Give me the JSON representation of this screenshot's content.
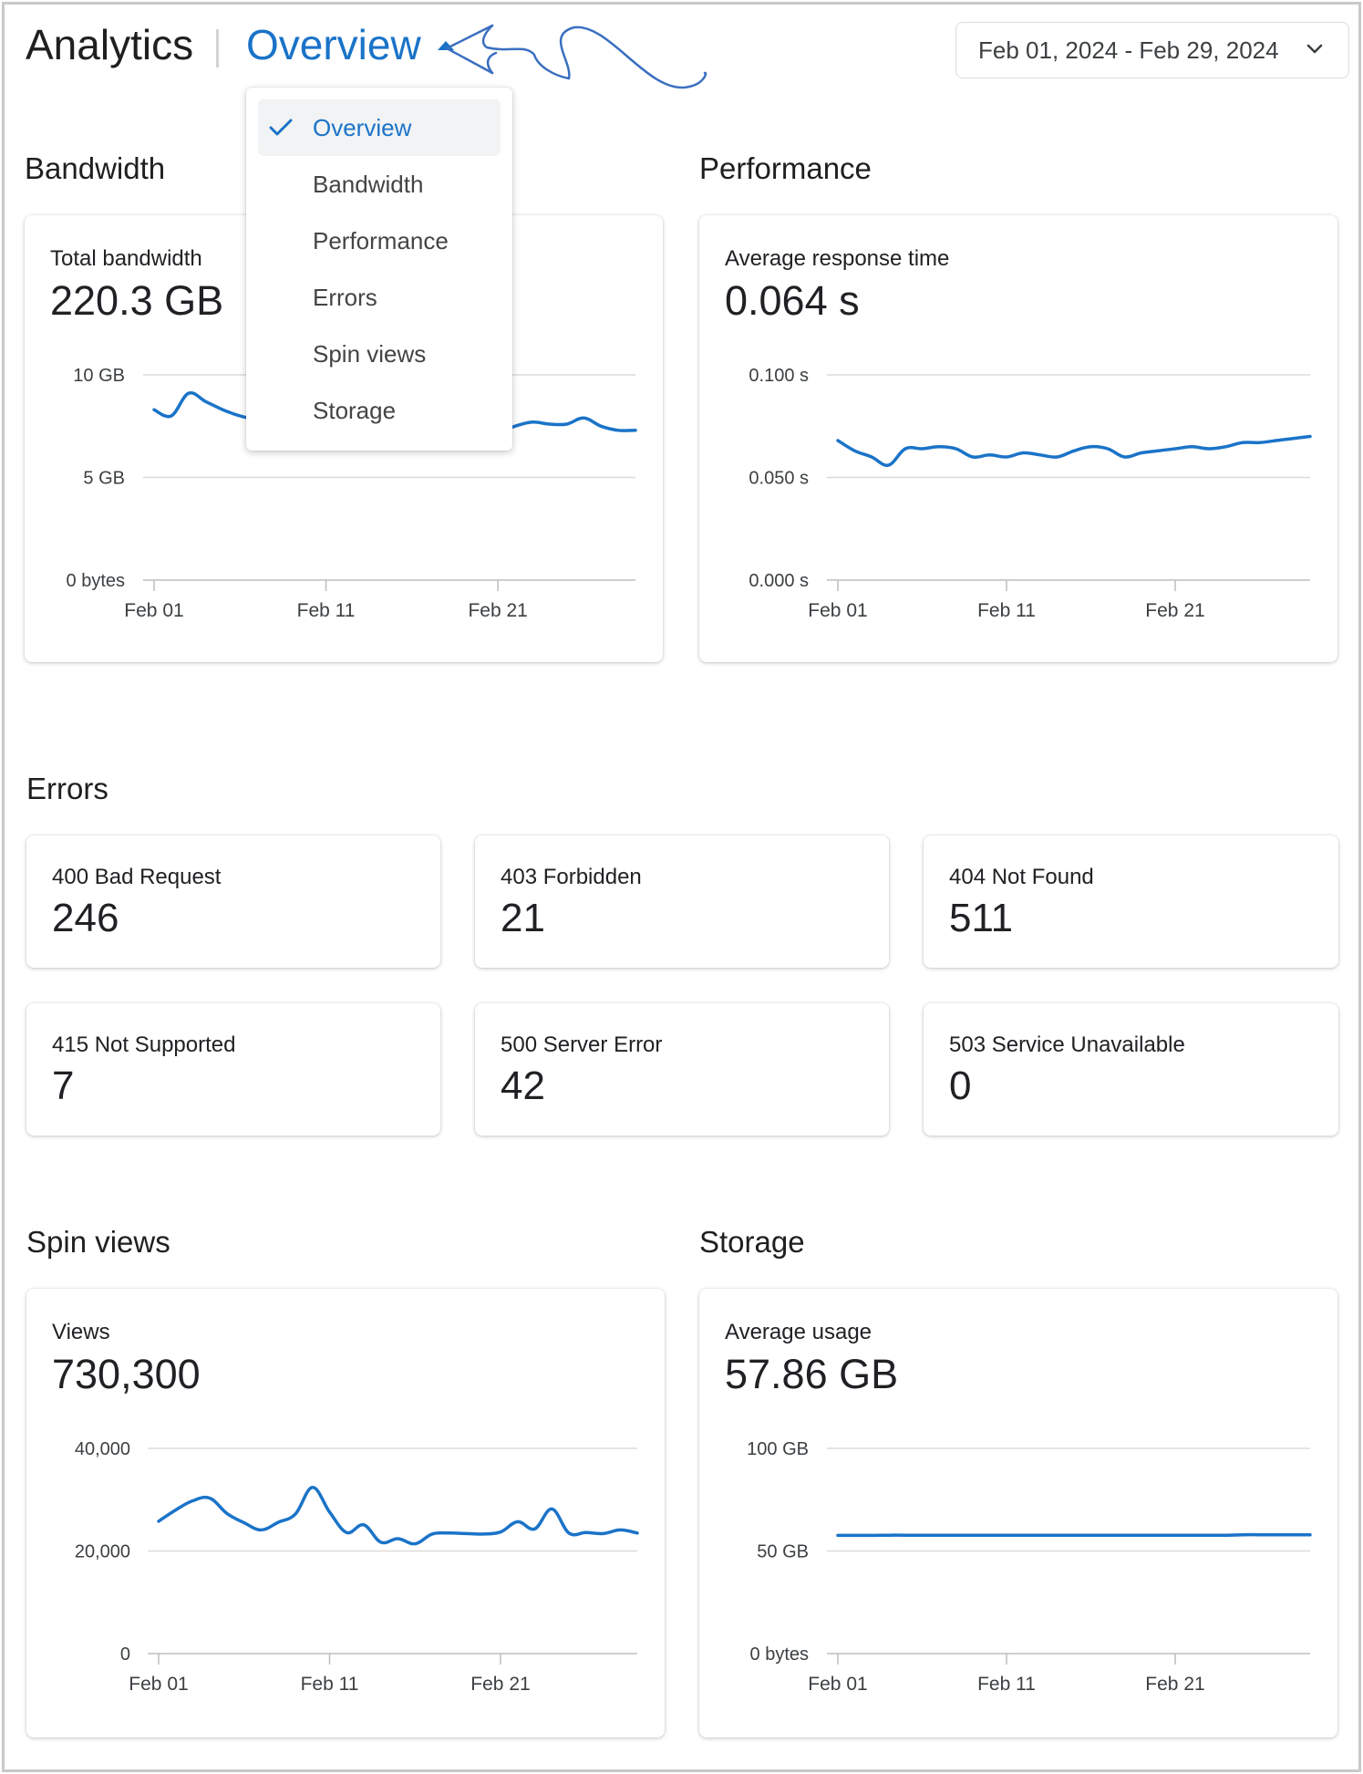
{
  "header": {
    "app_title": "Analytics",
    "section_selected": "Overview",
    "date_range": "Feb 01, 2024 - Feb 29, 2024"
  },
  "dropdown": {
    "items": [
      "Overview",
      "Bandwidth",
      "Performance",
      "Errors",
      "Spin views",
      "Storage"
    ],
    "selected": "Overview"
  },
  "colors": {
    "accent": "#1a73c8",
    "line": "#1a73c8"
  },
  "sections": {
    "bandwidth": "Bandwidth",
    "performance": "Performance",
    "errors": "Errors",
    "spin_views": "Spin views",
    "storage": "Storage"
  },
  "bandwidth": {
    "label": "Total bandwidth",
    "value": "220.3 GB"
  },
  "performance": {
    "label": "Average response time",
    "value": "0.064 s"
  },
  "spin_views": {
    "label": "Views",
    "value": "730,300"
  },
  "storage": {
    "label": "Average usage",
    "value": "57.86 GB"
  },
  "errors": [
    {
      "label": "400 Bad Request",
      "value": "246"
    },
    {
      "label": "403 Forbidden",
      "value": "21"
    },
    {
      "label": "404 Not Found",
      "value": "511"
    },
    {
      "label": "415 Not Supported",
      "value": "7"
    },
    {
      "label": "500 Server Error",
      "value": "42"
    },
    {
      "label": "503 Service Unavailable",
      "value": "0"
    }
  ],
  "chart_data": [
    {
      "type": "line",
      "title": "Total bandwidth",
      "x_ticks": [
        "Feb 01",
        "Feb 11",
        "Feb 21"
      ],
      "y_ticks": [
        "0 bytes",
        "5 GB",
        "10 GB"
      ],
      "ylim": [
        0,
        10
      ],
      "x": [
        1,
        2,
        3,
        4,
        5,
        6,
        7,
        8,
        9,
        10,
        11,
        12,
        13,
        14,
        15,
        16,
        17,
        18,
        19,
        20,
        21,
        22,
        23,
        24,
        25,
        26,
        27,
        28,
        29
      ],
      "series": [
        {
          "values": [
            8.3,
            8.0,
            9.1,
            8.7,
            8.3,
            8.0,
            7.8,
            7.6,
            7.3,
            7.0,
            6.8,
            6.6,
            6.5,
            6.4,
            6.6,
            6.9,
            7.2,
            7.3,
            7.3,
            7.2,
            7.2,
            7.5,
            7.7,
            7.6,
            7.6,
            7.9,
            7.5,
            7.3,
            7.3
          ]
        }
      ]
    },
    {
      "type": "line",
      "title": "Average response time",
      "x_ticks": [
        "Feb 01",
        "Feb 11",
        "Feb 21"
      ],
      "y_ticks": [
        "0.000 s",
        "0.050 s",
        "0.100 s"
      ],
      "ylim": [
        0,
        0.1
      ],
      "x": [
        1,
        2,
        3,
        4,
        5,
        6,
        7,
        8,
        9,
        10,
        11,
        12,
        13,
        14,
        15,
        16,
        17,
        18,
        19,
        20,
        21,
        22,
        23,
        24,
        25,
        26,
        27,
        28,
        29
      ],
      "series": [
        {
          "values": [
            0.068,
            0.063,
            0.06,
            0.056,
            0.064,
            0.064,
            0.065,
            0.064,
            0.06,
            0.061,
            0.06,
            0.062,
            0.061,
            0.06,
            0.063,
            0.065,
            0.064,
            0.06,
            0.062,
            0.063,
            0.064,
            0.065,
            0.064,
            0.065,
            0.067,
            0.067,
            0.068,
            0.069,
            0.07
          ]
        }
      ]
    },
    {
      "type": "line",
      "title": "Views",
      "x_ticks": [
        "Feb 01",
        "Feb 11",
        "Feb 21"
      ],
      "y_ticks": [
        "0",
        "20,000",
        "40,000"
      ],
      "ylim": [
        0,
        40000
      ],
      "x": [
        1,
        2,
        3,
        4,
        5,
        6,
        7,
        8,
        9,
        10,
        11,
        12,
        13,
        14,
        15,
        16,
        17,
        18,
        19,
        20,
        21,
        22,
        23,
        24,
        25,
        26,
        27,
        28,
        29
      ],
      "series": [
        {
          "values": [
            25800,
            28000,
            29800,
            30300,
            27300,
            25500,
            24100,
            25600,
            27200,
            32400,
            27600,
            23600,
            25100,
            21700,
            22400,
            21400,
            23300,
            23500,
            23400,
            23300,
            23700,
            25700,
            24300,
            28200,
            23500,
            23600,
            23400,
            24100,
            23500
          ]
        }
      ]
    },
    {
      "type": "line",
      "title": "Average usage",
      "x_ticks": [
        "Feb 01",
        "Feb 11",
        "Feb 21"
      ],
      "y_ticks": [
        "0 bytes",
        "50 GB",
        "100 GB"
      ],
      "ylim": [
        0,
        100
      ],
      "x": [
        1,
        2,
        3,
        4,
        5,
        6,
        7,
        8,
        9,
        10,
        11,
        12,
        13,
        14,
        15,
        16,
        17,
        18,
        19,
        20,
        21,
        22,
        23,
        24,
        25,
        26,
        27,
        28,
        29
      ],
      "series": [
        {
          "values": [
            57.6,
            57.6,
            57.6,
            57.7,
            57.7,
            57.7,
            57.7,
            57.7,
            57.7,
            57.7,
            57.7,
            57.7,
            57.7,
            57.7,
            57.7,
            57.7,
            57.7,
            57.7,
            57.7,
            57.7,
            57.7,
            57.7,
            57.7,
            57.7,
            57.9,
            57.9,
            57.9,
            57.9,
            57.9
          ]
        }
      ]
    }
  ]
}
